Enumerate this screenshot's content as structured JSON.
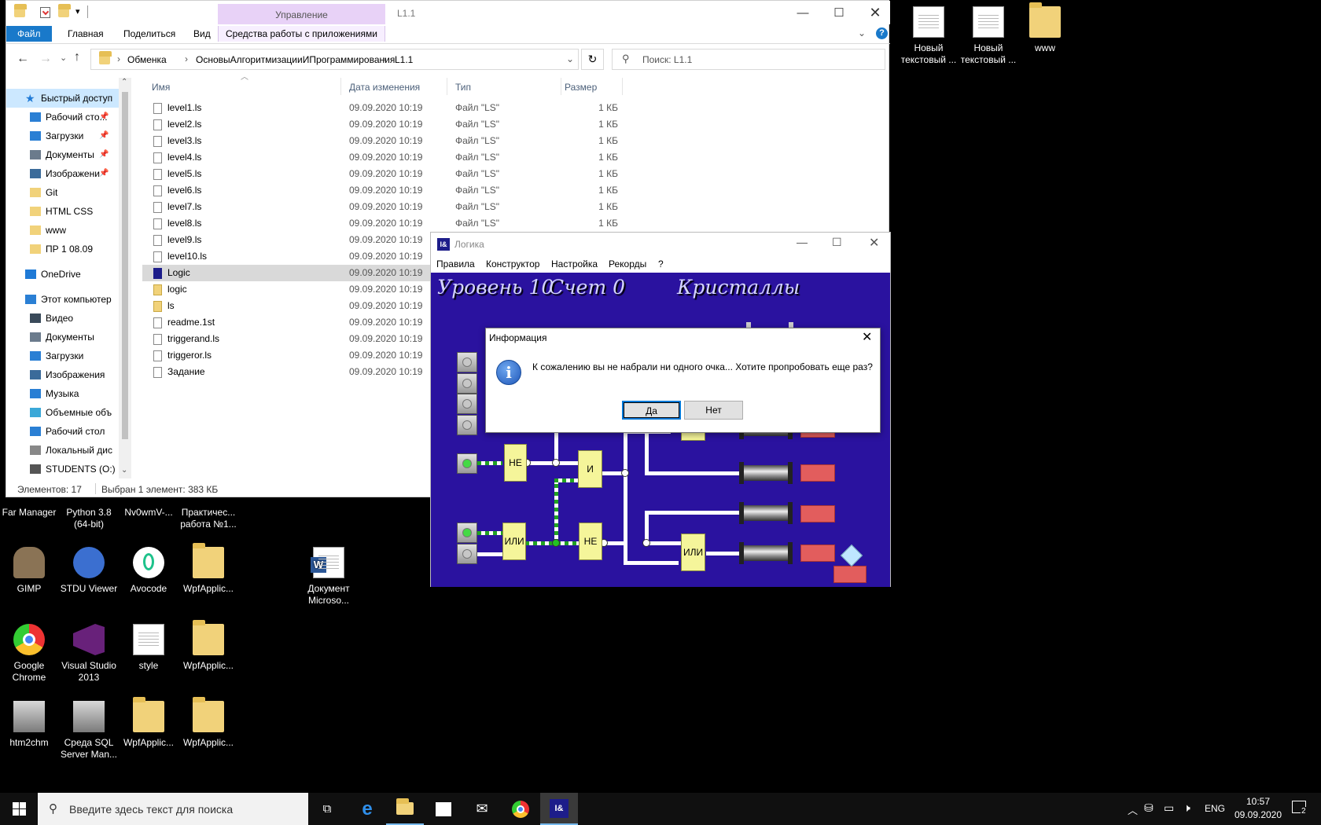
{
  "desktop": {
    "right_icons": [
      {
        "label": "Новый текстовый ...",
        "icon": "text-file-icon"
      },
      {
        "label": "Новый текстовый ...",
        "icon": "text-file-icon"
      },
      {
        "label": "www",
        "icon": "edge-folder-icon"
      }
    ],
    "icons": [
      {
        "label": "Far Manager",
        "icon": "far-manager-icon"
      },
      {
        "label": "Python 3.8 (64-bit)",
        "icon": "python-icon"
      },
      {
        "label": "Nv0wmV-...",
        "icon": "image-file-icon"
      },
      {
        "label": "Практичес... работа №1...",
        "icon": "document-icon"
      },
      {
        "label": "GIMP",
        "icon": "gimp-icon"
      },
      {
        "label": "STDU Viewer",
        "icon": "stdu-viewer-icon"
      },
      {
        "label": "Avocode",
        "icon": "avocode-icon"
      },
      {
        "label": "WpfApplic...",
        "icon": "folder-icon"
      },
      {
        "label": "Документ Microso...",
        "icon": "word-document-icon"
      },
      {
        "label": "Google Chrome",
        "icon": "chrome-icon"
      },
      {
        "label": "Visual Studio 2013",
        "icon": "visual-studio-icon"
      },
      {
        "label": "style",
        "icon": "settings-file-icon"
      },
      {
        "label": "WpfApplic...",
        "icon": "folder-icon"
      },
      {
        "label": "htm2chm",
        "icon": "htm2chm-icon"
      },
      {
        "label": "Среда SQL Server Man...",
        "icon": "sql-server-icon"
      },
      {
        "label": "WpfApplic...",
        "icon": "folder-icon"
      },
      {
        "label": "WpfApplic...",
        "icon": "folder-icon"
      }
    ]
  },
  "explorer": {
    "title": "L1.1",
    "manage_label": "Управление",
    "tabs": [
      "Файл",
      "Главная",
      "Поделиться",
      "Вид",
      "Средства работы с приложениями"
    ],
    "breadcrumb": [
      "Обменка",
      "ОсновыАлгоритмизацииИПрограммирования",
      "L1.1"
    ],
    "search_placeholder": "Поиск: L1.1",
    "nav": [
      {
        "label": "Быстрый доступ",
        "icon": "star-icon",
        "pinned": false,
        "indent": 0,
        "selected": true
      },
      {
        "label": "Рабочий сто...",
        "icon": "desktop-icon",
        "pinned": true,
        "indent": 1
      },
      {
        "label": "Загрузки",
        "icon": "download-icon",
        "pinned": true,
        "indent": 1
      },
      {
        "label": "Документы",
        "icon": "documents-icon",
        "pinned": true,
        "indent": 1
      },
      {
        "label": "Изображени",
        "icon": "pictures-icon",
        "pinned": true,
        "indent": 1
      },
      {
        "label": "Git",
        "icon": "folder-icon",
        "pinned": false,
        "indent": 1
      },
      {
        "label": "HTML CSS",
        "icon": "folder-icon",
        "pinned": false,
        "indent": 1
      },
      {
        "label": "www",
        "icon": "folder-icon",
        "pinned": false,
        "indent": 1
      },
      {
        "label": "ПР 1 08.09",
        "icon": "folder-icon",
        "pinned": false,
        "indent": 1
      },
      {
        "label": "OneDrive",
        "icon": "cloud-icon",
        "pinned": false,
        "indent": 0
      },
      {
        "label": "Этот компьютер",
        "icon": "computer-icon",
        "pinned": false,
        "indent": 0
      },
      {
        "label": "Видео",
        "icon": "video-icon",
        "pinned": false,
        "indent": 1
      },
      {
        "label": "Документы",
        "icon": "documents-icon",
        "pinned": false,
        "indent": 1
      },
      {
        "label": "Загрузки",
        "icon": "download-icon",
        "pinned": false,
        "indent": 1
      },
      {
        "label": "Изображения",
        "icon": "pictures-icon",
        "pinned": false,
        "indent": 1
      },
      {
        "label": "Музыка",
        "icon": "music-icon",
        "pinned": false,
        "indent": 1
      },
      {
        "label": "Объемные объ",
        "icon": "3d-objects-icon",
        "pinned": false,
        "indent": 1
      },
      {
        "label": "Рабочий стол",
        "icon": "desktop-icon",
        "pinned": false,
        "indent": 1
      },
      {
        "label": "Локальный дис",
        "icon": "drive-icon",
        "pinned": false,
        "indent": 1
      },
      {
        "label": "STUDENTS (O:)",
        "icon": "network-drive-icon",
        "pinned": false,
        "indent": 1
      }
    ],
    "columns": [
      "Имя",
      "Дата изменения",
      "Тип",
      "Размер"
    ],
    "files": [
      {
        "name": "level1.ls",
        "date": "09.09.2020 10:19",
        "type": "Файл \"LS\"",
        "size": "1 КБ"
      },
      {
        "name": "level2.ls",
        "date": "09.09.2020 10:19",
        "type": "Файл \"LS\"",
        "size": "1 КБ"
      },
      {
        "name": "level3.ls",
        "date": "09.09.2020 10:19",
        "type": "Файл \"LS\"",
        "size": "1 КБ"
      },
      {
        "name": "level4.ls",
        "date": "09.09.2020 10:19",
        "type": "Файл \"LS\"",
        "size": "1 КБ"
      },
      {
        "name": "level5.ls",
        "date": "09.09.2020 10:19",
        "type": "Файл \"LS\"",
        "size": "1 КБ"
      },
      {
        "name": "level6.ls",
        "date": "09.09.2020 10:19",
        "type": "Файл \"LS\"",
        "size": "1 КБ"
      },
      {
        "name": "level7.ls",
        "date": "09.09.2020 10:19",
        "type": "Файл \"LS\"",
        "size": "1 КБ"
      },
      {
        "name": "level8.ls",
        "date": "09.09.2020 10:19",
        "type": "Файл \"LS\"",
        "size": "1 КБ"
      },
      {
        "name": "level9.ls",
        "date": "09.09.2020 10:19",
        "type": "",
        "size": ""
      },
      {
        "name": "level10.ls",
        "date": "09.09.2020 10:19",
        "type": "",
        "size": ""
      },
      {
        "name": "Logic",
        "date": "09.09.2020 10:19",
        "type": "",
        "size": "",
        "selected": true
      },
      {
        "name": "logic",
        "date": "09.09.2020 10:19",
        "type": "",
        "size": ""
      },
      {
        "name": "ls",
        "date": "09.09.2020 10:19",
        "type": "",
        "size": ""
      },
      {
        "name": "readme.1st",
        "date": "09.09.2020 10:19",
        "type": "",
        "size": ""
      },
      {
        "name": "triggerand.ls",
        "date": "09.09.2020 10:19",
        "type": "",
        "size": ""
      },
      {
        "name": "triggeror.ls",
        "date": "09.09.2020 10:19",
        "type": "",
        "size": ""
      },
      {
        "name": "Задание",
        "date": "09.09.2020 10:19",
        "type": "",
        "size": ""
      }
    ],
    "status_count": "Элементов: 17",
    "status_selected": "Выбран 1 элемент: 383 КБ"
  },
  "logic": {
    "title": "Логика",
    "menu": [
      "Правила",
      "Конструктор",
      "Настройка",
      "Рекорды",
      "?"
    ],
    "header_level": "Уровень  10",
    "header_score": "Счет  0",
    "header_crystals": "Кристаллы",
    "gates": [
      "НЕ",
      "И",
      "ИЛИ",
      "НЕ",
      "ИЛИ"
    ]
  },
  "dialog": {
    "title": "Информация",
    "message": "К сожалению вы не набрали ни одного очка... Хотите пропробовать еще раз?",
    "yes": "Да",
    "no": "Нет"
  },
  "taskbar": {
    "search_placeholder": "Введите здесь текст для поиска",
    "lang": "ENG",
    "time": "10:57",
    "date": "09.09.2020",
    "notifications": "2"
  }
}
